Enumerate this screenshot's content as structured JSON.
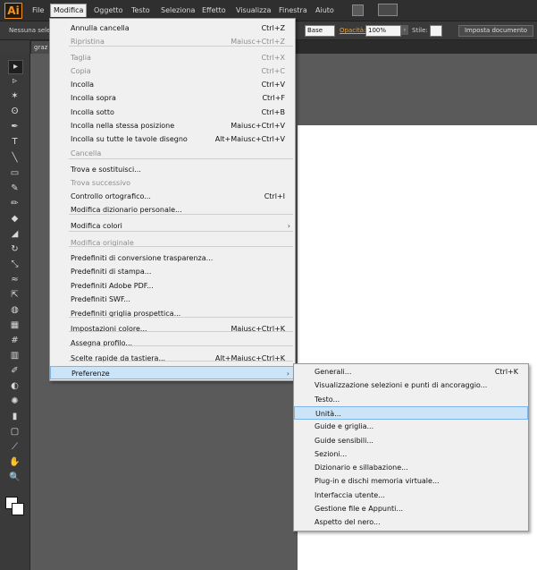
{
  "app": {
    "logo": "Ai",
    "accent": "#f7931e"
  },
  "menubar": [
    {
      "label": "File"
    },
    {
      "label": "Modifica"
    },
    {
      "label": "Oggetto"
    },
    {
      "label": "Testo"
    },
    {
      "label": "Seleziona"
    },
    {
      "label": "Effetto"
    },
    {
      "label": "Visualizza"
    },
    {
      "label": "Finestra"
    },
    {
      "label": "Aiuto"
    }
  ],
  "controlbar": {
    "selection": "Nessuna selez",
    "stroke_profile": "Base",
    "opacity_label": "Opacità:",
    "opacity_value": "100%",
    "style_label": "Stile:",
    "doc_setup": "Imposta documento"
  },
  "tabs": {
    "doc": "graz"
  },
  "tools": [
    "selection-tool",
    "direct-selection-tool",
    "magic-wand-tool",
    "lasso-tool",
    "pen-tool",
    "type-tool",
    "line-tool",
    "rectangle-tool",
    "paintbrush-tool",
    "pencil-tool",
    "blob-brush-tool",
    "eraser-tool",
    "rotate-tool",
    "scale-tool",
    "width-tool",
    "free-transform-tool",
    "shape-builder-tool",
    "perspective-grid-tool",
    "mesh-tool",
    "gradient-tool",
    "eyedropper-tool",
    "blend-tool",
    "symbol-sprayer-tool",
    "column-graph-tool",
    "artboard-tool",
    "slice-tool",
    "hand-tool",
    "zoom-tool"
  ],
  "modifica_menu": [
    {
      "label": "Annulla cancella",
      "shortcut": "Ctrl+Z",
      "disabled": false
    },
    {
      "label": "Ripristina",
      "shortcut": "Maiusc+Ctrl+Z",
      "disabled": true
    },
    {
      "label": "Taglia",
      "shortcut": "Ctrl+X",
      "disabled": true
    },
    {
      "label": "Copia",
      "shortcut": "Ctrl+C",
      "disabled": true
    },
    {
      "label": "Incolla",
      "shortcut": "Ctrl+V",
      "disabled": false
    },
    {
      "label": "Incolla sopra",
      "shortcut": "Ctrl+F",
      "disabled": false
    },
    {
      "label": "Incolla sotto",
      "shortcut": "Ctrl+B",
      "disabled": false
    },
    {
      "label": "Incolla nella stessa posizione",
      "shortcut": "Maiusc+Ctrl+V",
      "disabled": false
    },
    {
      "label": "Incolla su tutte le tavole disegno",
      "shortcut": "Alt+Maiusc+Ctrl+V",
      "disabled": false
    },
    {
      "label": "Cancella",
      "shortcut": "",
      "disabled": true
    },
    {
      "label": "Trova e sostituisci...",
      "shortcut": "",
      "disabled": false
    },
    {
      "label": "Trova successivo",
      "shortcut": "",
      "disabled": true
    },
    {
      "label": "Controllo ortografico...",
      "shortcut": "Ctrl+I",
      "disabled": false
    },
    {
      "label": "Modifica dizionario personale...",
      "shortcut": "",
      "disabled": false
    },
    {
      "label": "Modifica colori",
      "shortcut": "",
      "disabled": false,
      "submenu": true
    },
    {
      "label": "Modifica originale",
      "shortcut": "",
      "disabled": true
    },
    {
      "label": "Predefiniti di conversione trasparenza...",
      "shortcut": "",
      "disabled": false
    },
    {
      "label": "Predefiniti di stampa...",
      "shortcut": "",
      "disabled": false
    },
    {
      "label": "Predefiniti Adobe PDF...",
      "shortcut": "",
      "disabled": false
    },
    {
      "label": "Predefiniti SWF...",
      "shortcut": "",
      "disabled": false
    },
    {
      "label": "Predefiniti griglia prospettica...",
      "shortcut": "",
      "disabled": false
    },
    {
      "label": "Impostazioni colore...",
      "shortcut": "Maiusc+Ctrl+K",
      "disabled": false
    },
    {
      "label": "Assegna profilo...",
      "shortcut": "",
      "disabled": false
    },
    {
      "label": "Scelte rapide da tastiera...",
      "shortcut": "Alt+Maiusc+Ctrl+K",
      "disabled": false
    },
    {
      "label": "Preferenze",
      "shortcut": "",
      "disabled": false,
      "submenu": true,
      "highlighted": true
    }
  ],
  "pref_menu": [
    {
      "label": "Generali...",
      "shortcut": "Ctrl+K"
    },
    {
      "label": "Visualizzazione selezioni e punti di ancoraggio...",
      "shortcut": ""
    },
    {
      "label": "Testo...",
      "shortcut": ""
    },
    {
      "label": "Unità...",
      "shortcut": "",
      "highlighted": true
    },
    {
      "label": "Guide e griglia...",
      "shortcut": ""
    },
    {
      "label": "Guide sensibili...",
      "shortcut": ""
    },
    {
      "label": "Sezioni...",
      "shortcut": ""
    },
    {
      "label": "Dizionario e sillabazione...",
      "shortcut": ""
    },
    {
      "label": "Plug-in e dischi memoria virtuale...",
      "shortcut": ""
    },
    {
      "label": "Interfaccia utente...",
      "shortcut": ""
    },
    {
      "label": "Gestione file e Appunti...",
      "shortcut": ""
    },
    {
      "label": "Aspetto del nero...",
      "shortcut": ""
    }
  ]
}
